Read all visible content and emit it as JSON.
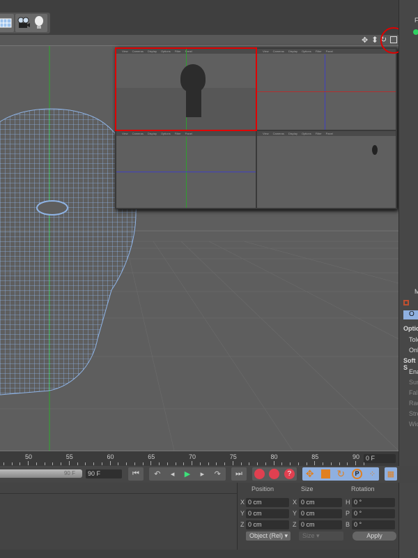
{
  "toolbar": {
    "icons": [
      "floor-icon",
      "camera-icon",
      "light-icon"
    ]
  },
  "viewport": {
    "nav_icons": [
      "move-view-icon",
      "zoom-view-icon",
      "rotate-view-icon",
      "toggle-layout-icon"
    ],
    "highlight_color": "#e00000",
    "wire_color": "#8fb4e6"
  },
  "inset": {
    "menu": [
      "View",
      "Cameras",
      "Display",
      "Options",
      "Filter",
      "Panel"
    ]
  },
  "timeline": {
    "ticks": [
      "50",
      "55",
      "60",
      "65",
      "70",
      "75",
      "80",
      "85",
      "90"
    ],
    "current_frame": "0 F"
  },
  "transport": {
    "range_end": "90 F",
    "end_frame": "90 F"
  },
  "coordinates": {
    "headers": [
      "Position",
      "Size",
      "Rotation"
    ],
    "rows": [
      {
        "a": "X",
        "pos": "0 cm",
        "b": "X",
        "size": "0 cm",
        "c": "H",
        "rot": "0 °"
      },
      {
        "a": "Y",
        "pos": "0 cm",
        "b": "Y",
        "size": "0 cm",
        "c": "P",
        "rot": "0 °"
      },
      {
        "a": "Z",
        "pos": "0 cm",
        "b": "Z",
        "size": "0 cm",
        "c": "B",
        "rot": "0 °"
      }
    ],
    "mode": "Object (Rel)",
    "size_mode": "Size",
    "apply": "Apply"
  },
  "right_panel": {
    "top_label": "F",
    "attr_label": "M",
    "tab": "O",
    "items": [
      "Optic",
      "Tole",
      "Onl",
      "Soft S",
      "Ena",
      "Sur",
      "Fall",
      "Rac",
      "Stre",
      "Wic"
    ]
  }
}
